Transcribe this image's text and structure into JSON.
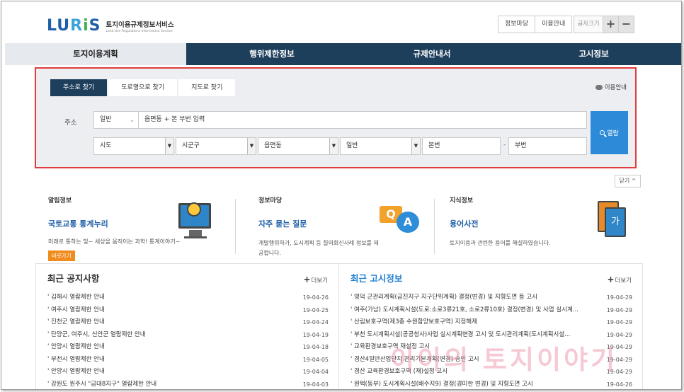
{
  "header": {
    "logo_text": "LURIS",
    "service_name": "토지이용규제정보서비스",
    "service_name_en": "Land Use Regulations Information Service",
    "util_buttons": [
      "정보마당",
      "이용안내"
    ],
    "font_size_label": "글자크기",
    "font_plus": "+",
    "font_minus": "−"
  },
  "nav": {
    "items": [
      "토지이용계획",
      "행위제한정보",
      "규제안내서",
      "고시정보"
    ],
    "active": "토지이용계획"
  },
  "search": {
    "tabs": [
      "주소로 찾기",
      "도로명으로 찾기",
      "지도로 찾기"
    ],
    "active_tab": "주소로 찾기",
    "help_label": "이용안내",
    "address_label": "주소",
    "type_select": "일반",
    "address_placeholder": "읍면동 + 본 부번 입력",
    "selects": [
      "시도",
      "시군구",
      "읍면동",
      "일반"
    ],
    "bonbun_placeholder": "본번",
    "bubun_placeholder": "부번",
    "dash": "-",
    "search_button": "열람",
    "close_button": "닫기 ^"
  },
  "info": [
    {
      "category": "알림정보",
      "title": "국토교통 통계누리",
      "desc": "미래로 통하는 빛~ 세상을 움직이는 과학! 통계이야기~",
      "button": "바로가기"
    },
    {
      "category": "정보마당",
      "title": "자주 묻는 질문",
      "desc": "개발행위하가, 도시계획 등 질의회신사례 정보를 제공합니다.",
      "icon_q": "Q",
      "icon_a": "A"
    },
    {
      "category": "지식정보",
      "title": "용어사전",
      "desc": "토지이용과 관련한 용어를 해설하였습니다.",
      "icon_text": "가"
    }
  ],
  "notices": {
    "title": "최근 공지사항",
    "more": "더보기",
    "items": [
      {
        "text": "김해시 열람제한 안내",
        "date": "19-04-26"
      },
      {
        "text": "여주시 열람제한 안내",
        "date": "19-04-25"
      },
      {
        "text": "진천군 열람제한 안내",
        "date": "19-04-24"
      },
      {
        "text": "단양군, 여주시, 신안군 열람제한 안내",
        "date": "19-04-19"
      },
      {
        "text": "안양시 열람제한 안내",
        "date": "19-04-18"
      },
      {
        "text": "부천시 열람제한 안내",
        "date": "19-04-05"
      },
      {
        "text": "안양시 열람제한 안내",
        "date": "19-04-04"
      },
      {
        "text": "강원도 원주시 \"금대8지구\" 열람제한 안내",
        "date": "19-04-03"
      }
    ]
  },
  "gosi": {
    "title": "최근 고시정보",
    "more": "더보기",
    "items": [
      {
        "text": "영덕 군관리계획(금진지구 지구단위계획) 결정(변경) 및 지형도면 등 고시",
        "date": "19-04-29"
      },
      {
        "text": "여주(가남) 도시계획시설(도로:소로3류21호, 소로2류10호) 결정(변경) 및 사업 실시계...",
        "date": "19-04-29"
      },
      {
        "text": "산림보호구역(제3종 수원함양보호구역) 지정해제",
        "date": "19-04-29"
      },
      {
        "text": "부천 도시계획시설(공공청사)사업 실시계획변경 고시 및 도시관리계획(도시계획시설...",
        "date": "19-04-29"
      },
      {
        "text": "교육환경보호구역 재설정 고시",
        "date": "19-04-29"
      },
      {
        "text": "경산4일반산업단지 관리기본계획(변경) 승인 고시",
        "date": "19-04-29"
      },
      {
        "text": "경산 교육환경보호구역 (재)설정 고시",
        "date": "19-04-29"
      },
      {
        "text": "원택(동부) 도시계획시설(배수지9) 결정(경미한 변경) 및 지형도면 고시",
        "date": "19-04-26"
      }
    ]
  },
  "watermark": "이이의 토지이야기"
}
